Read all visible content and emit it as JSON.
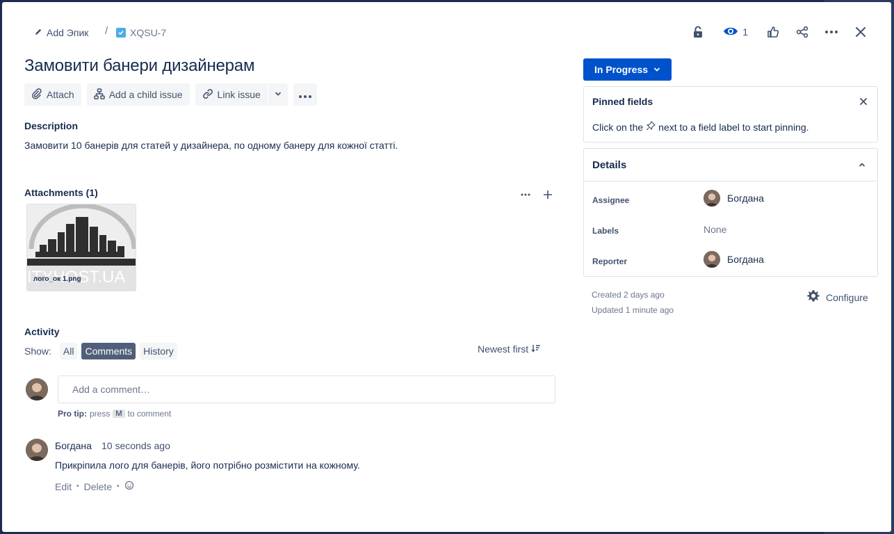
{
  "breadcrumb": {
    "epic_label": "Add Эпик",
    "separator": "/",
    "issue_key": "XQSU-7"
  },
  "header_actions": {
    "watch_count": "1",
    "icons": [
      "lock-icon",
      "eye-icon",
      "thumbs-up-icon",
      "share-icon",
      "more-icon",
      "close-icon"
    ]
  },
  "issue": {
    "title": "Замовити банери дизайнерам"
  },
  "toolbar": {
    "attach_label": "Attach",
    "child_issue_label": "Add a child issue",
    "link_issue_label": "Link issue"
  },
  "description": {
    "label": "Description",
    "text": "Замовити 10 банерів для статей у дизайнера, по одному банеру для кожної статті."
  },
  "attachments": {
    "label": "Attachments (1)",
    "files": [
      {
        "name": "лого_ок 1.png",
        "watermark": "ITYHOST.UA"
      }
    ]
  },
  "activity": {
    "label": "Activity",
    "show_label": "Show:",
    "filters": [
      "All",
      "Comments",
      "History"
    ],
    "active_filter": "Comments",
    "sort_label": "Newest first",
    "comment_placeholder": "Add a comment…",
    "protip_prefix": "Pro tip:",
    "protip_press": "press",
    "protip_key": "M",
    "protip_suffix": "to comment",
    "comments": [
      {
        "author": "Богдана",
        "time": "10 seconds ago",
        "text": "Прикріпила лого для банерів, його потрібно розмістити на кожному.",
        "edit_label": "Edit",
        "delete_label": "Delete"
      }
    ]
  },
  "status": {
    "label": "In Progress",
    "color": "#0052cc"
  },
  "pinned": {
    "title": "Pinned fields",
    "text_before": "Click on the",
    "text_after": "next to a field label to start pinning."
  },
  "details": {
    "title": "Details",
    "fields": [
      {
        "label": "Assignee",
        "value": "Богдана"
      },
      {
        "label": "Labels",
        "value": "None"
      },
      {
        "label": "Reporter",
        "value": "Богдана"
      }
    ]
  },
  "meta": {
    "created": "Created 2 days ago",
    "updated": "Updated 1 minute ago",
    "configure_label": "Configure"
  }
}
